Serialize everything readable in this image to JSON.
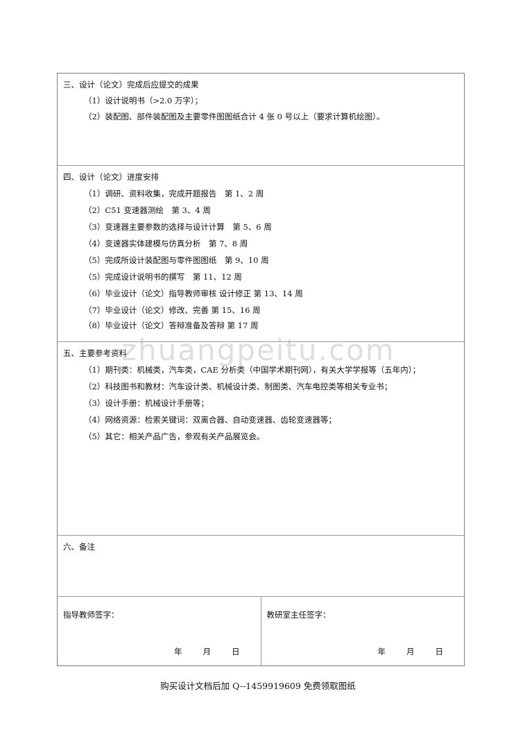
{
  "section3": {
    "heading": "三、设计（论文）完成后应提交的成果",
    "items": [
      "（1）设计说明书（>2.0 万字）；",
      "（2）装配图、部件装配图及主要零件图图纸合计 4 张 0 号以上（要求计算机绘图）。"
    ]
  },
  "section4": {
    "heading": "四、设计（论文）进度安排",
    "items": [
      "（1）调研、资料收集，完成开题报告　第 1、2 周",
      "（2）C51 变速器测绘　第 3、4 周",
      "（3）变速器主要参数的选择与设计计算　第 5、6 周",
      "（4）变速器实体建模与仿真分析　第 7、8 周",
      "（5）完成所设计装配图与零件图图纸　第 9、10 周",
      "（5）完成设计说明书的撰写　第 11、12 周",
      "（6）毕业设计（论文）指导教师审核 设计修正 第 13、14 周",
      "（7）毕业设计（论文）修改、完善 第 15、16 周",
      "（8）毕业设计（论文）答辩准备及答辩 第 17 周"
    ]
  },
  "section5": {
    "heading": "五、主要参考资料",
    "items": [
      "（1）期刊类：机械类，汽车类，CAE 分析类（中国学术期刊网），有关大学学报等（五年内）；",
      "（2）科技图书和教材：汽车设计类、机械设计类、制图类、汽车电控类等相关专业书；",
      "（3）设计手册：机械设计手册等；",
      "（4）网络资源：检索关键词：双离合器、自动变速器、齿轮变速器等；",
      "（5）其它：相关产品广告，参观有关产品展览会。"
    ]
  },
  "section6": {
    "heading": "六、备注"
  },
  "signatures": {
    "advisor_label": "指导教师签字：",
    "director_label": "教研室主任签字：",
    "year": "年",
    "month": "月",
    "day": "日"
  },
  "watermark": "zhuangpeitu.com",
  "footer": "购买设计文档后加 Q--1459919609 免费领取图纸"
}
